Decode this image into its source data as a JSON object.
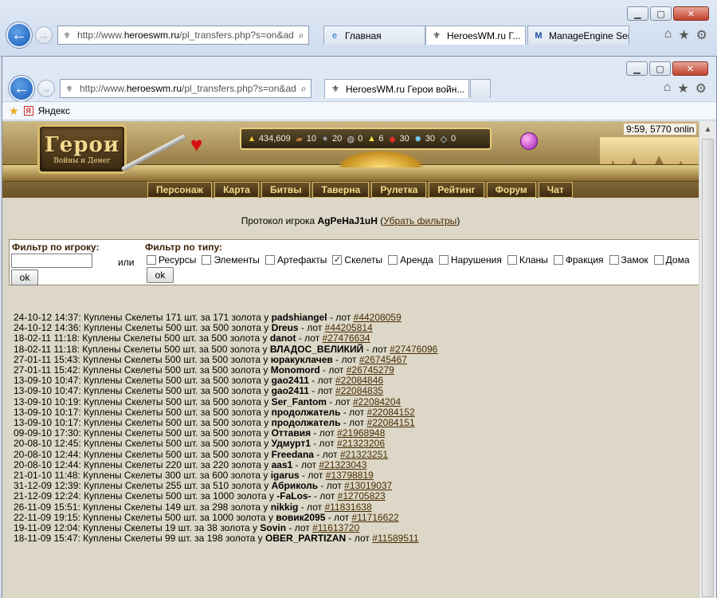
{
  "back_window": {
    "url_prefix": "http://www.",
    "url_host": "heroeswm.ru",
    "url_rest": "/pl_transfers.php?s=on&ad",
    "tabs": [
      {
        "label": "Главная"
      },
      {
        "label": "HeroesWM.ru Г..."
      },
      {
        "label": "ManageEngine Ser..."
      }
    ]
  },
  "front_window": {
    "url_prefix": "http://www.",
    "url_host": "heroeswm.ru",
    "url_rest": "/pl_transfers.php?s=on&ad",
    "tab_label": "HeroesWM.ru Герои войн...",
    "favorites": [
      {
        "label": "Яндекс"
      }
    ]
  },
  "header": {
    "logo_title": "Герои",
    "logo_subtitle": "Войны и Денег",
    "time": "9:59, 5770 onlin",
    "resources": [
      {
        "icon": "gold-icon",
        "glyph": "▲",
        "color": "#f2c230",
        "value": "434,609"
      },
      {
        "icon": "wood-icon",
        "glyph": "▰",
        "color": "#b07a3c",
        "value": "10"
      },
      {
        "icon": "ore-icon",
        "glyph": "●",
        "color": "#9aa0a6",
        "value": "20"
      },
      {
        "icon": "mercury-icon",
        "glyph": "◍",
        "color": "#c9c9c9",
        "value": "0"
      },
      {
        "icon": "sulfur-icon",
        "glyph": "▲",
        "color": "#f6e04a",
        "value": "6"
      },
      {
        "icon": "crystal-icon",
        "glyph": "◆",
        "color": "#e0332e",
        "value": "30"
      },
      {
        "icon": "gems-icon",
        "glyph": "✸",
        "color": "#7ad0ff",
        "value": "30"
      },
      {
        "icon": "diamond-icon",
        "glyph": "◇",
        "color": "#bfe8ff",
        "value": "0"
      }
    ],
    "menu": [
      "Персонаж",
      "Карта",
      "Битвы",
      "Таверна",
      "Рулетка",
      "Рейтинг",
      "Форум",
      "Чат"
    ]
  },
  "protocol": {
    "prefix": "Протокол игрока ",
    "player": "AgPeHaJ1uH",
    "open_paren": " (",
    "link": "Убрать фильтры",
    "close_paren": ")"
  },
  "filters": {
    "player_title": "Фильтр по игроку:",
    "player_value": "",
    "or_label": "или",
    "type_title": "Фильтр по типу:",
    "ok": "ok",
    "types": [
      {
        "label": "Ресурсы",
        "checked": false
      },
      {
        "label": "Элементы",
        "checked": false
      },
      {
        "label": "Артефакты",
        "checked": false
      },
      {
        "label": "Скелеты",
        "checked": true
      },
      {
        "label": "Аренда",
        "checked": false
      },
      {
        "label": "Нарушения",
        "checked": false
      },
      {
        "label": "Кланы",
        "checked": false
      },
      {
        "label": "Фракция",
        "checked": false
      },
      {
        "label": "Замок",
        "checked": false
      },
      {
        "label": "Дома",
        "checked": false
      }
    ]
  },
  "log": [
    {
      "date": "24-10-12 14:37: Куплены Скелеты 171 шт. за 171 золота у ",
      "seller": "padshiangel",
      "mid": " - лот ",
      "lot": "#44208059"
    },
    {
      "date": "24-10-12 14:36: Куплены Скелеты 500 шт. за 500 золота у ",
      "seller": "Dreus",
      "mid": " - лот ",
      "lot": "#44205814"
    },
    {
      "date": "18-02-11 11:18: Куплены Скелеты 500 шт. за 500 золота у ",
      "seller": "danot",
      "mid": " - лот ",
      "lot": "#27476634"
    },
    {
      "date": "18-02-11 11:18: Куплены Скелеты 500 шт. за 500 золота у ",
      "seller": "ВЛАДОС_ВЕЛИКИЙ",
      "mid": " - лот ",
      "lot": "#27476096"
    },
    {
      "date": "27-01-11 15:43: Куплены Скелеты 500 шт. за 500 золота у ",
      "seller": "юракуклачев",
      "mid": " - лот ",
      "lot": "#26745467"
    },
    {
      "date": "27-01-11 15:42: Куплены Скелеты 500 шт. за 500 золота у ",
      "seller": "Monomord",
      "mid": " - лот ",
      "lot": "#26745279"
    },
    {
      "date": "13-09-10 10:47: Куплены Скелеты 500 шт. за 500 золота у ",
      "seller": "gao2411",
      "mid": " - лот ",
      "lot": "#22084846"
    },
    {
      "date": "13-09-10 10:47: Куплены Скелеты 500 шт. за 500 золота у ",
      "seller": "gao2411",
      "mid": " - лот ",
      "lot": "#22084835"
    },
    {
      "date": "13-09-10 10:19: Куплены Скелеты 500 шт. за 500 золота у ",
      "seller": "Ser_Fantom",
      "mid": " - лот ",
      "lot": "#22084204"
    },
    {
      "date": "13-09-10 10:17: Куплены Скелеты 500 шт. за 500 золота у ",
      "seller": "продолжатель",
      "mid": " - лот ",
      "lot": "#22084152"
    },
    {
      "date": "13-09-10 10:17: Куплены Скелеты 500 шт. за 500 золота у ",
      "seller": "продолжатель",
      "mid": " - лот ",
      "lot": "#22084151"
    },
    {
      "date": "09-09-10 17:30: Куплены Скелеты 500 шт. за 500 золота у ",
      "seller": "Оттавия",
      "mid": " - лот ",
      "lot": "#21968948"
    },
    {
      "date": "20-08-10 12:45: Куплены Скелеты 500 шт. за 500 золота у ",
      "seller": "Удмурт1",
      "mid": " - лот ",
      "lot": "#21323206"
    },
    {
      "date": "20-08-10 12:44: Куплены Скелеты 500 шт. за 500 золота у ",
      "seller": "Freedana",
      "mid": " - лот ",
      "lot": "#21323251"
    },
    {
      "date": "20-08-10 12:44: Куплены Скелеты 220 шт. за 220 золота у ",
      "seller": "aas1",
      "mid": " - лот ",
      "lot": "#21323043"
    },
    {
      "date": "21-01-10 11:48: Куплены Скелеты 300 шт. за 600 золота у ",
      "seller": "igarus",
      "mid": " - лот ",
      "lot": "#13798819"
    },
    {
      "date": "31-12-09 12:39: Куплены Скелеты 255 шт. за 510 золота у ",
      "seller": "Абриколь",
      "mid": " - лот ",
      "lot": "#13019037"
    },
    {
      "date": "21-12-09 12:24: Куплены Скелеты 500 шт. за 1000 золота у ",
      "seller": "-FaLos-",
      "mid": " - лот ",
      "lot": "#12705823"
    },
    {
      "date": "26-11-09 15:51: Куплены Скелеты 149 шт. за 298 золота у ",
      "seller": "nikkig",
      "mid": " - лот ",
      "lot": "#11831638"
    },
    {
      "date": "22-11-09 19:15: Куплены Скелеты 500 шт. за 1000 золота у ",
      "seller": "вовик2095",
      "mid": " - лот ",
      "lot": "#11716622"
    },
    {
      "date": "19-11-09 12:04: Куплены Скелеты 19 шт. за 38 золота у ",
      "seller": "Sovin",
      "mid": " - лот ",
      "lot": "#11613720"
    },
    {
      "date": "18-11-09 15:47: Куплены Скелеты 99 шт. за 198 золота у ",
      "seller": "OBER_PARTIZAN",
      "mid": " - лот ",
      "lot": "#11589511"
    }
  ]
}
